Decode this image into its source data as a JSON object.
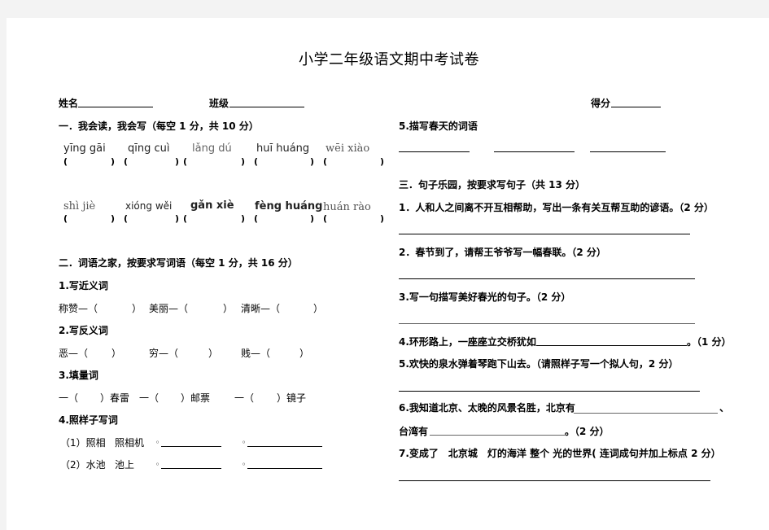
{
  "title": "小学二年级语文期中考试卷",
  "header": {
    "name_label": "姓名",
    "class_label": "班级",
    "score_label": "得分"
  },
  "section1": {
    "heading": "一．我会读，我会写（每空 1 分，共 10 分）",
    "pinyin_row1": [
      "yīng gāi",
      "qīng cuì",
      "lǎng dú",
      "huī huáng",
      "wēi xiào"
    ],
    "pinyin_row2": [
      "shì jiè",
      "xióng wěi",
      "gǎn xiè",
      "fèng huáng",
      "huán rào"
    ],
    "paren_open": "(",
    "paren_close": ")"
  },
  "section2": {
    "heading": "二．词语之家，按要求写词语（每空 1 分，共 16 分）",
    "q1": {
      "label": "1.写近义词",
      "items": [
        "称赞—（",
        "）",
        "美丽—（",
        "）",
        "清晰—（",
        "）"
      ]
    },
    "q2": {
      "label": "2.写反义词",
      "items": [
        "恶—（",
        "）",
        "穷—（",
        "）",
        "贱—（",
        "）"
      ]
    },
    "q3": {
      "label": "3.填量词",
      "items": [
        "一（",
        "）春雷",
        "一（",
        "）邮票",
        "一（",
        "）镜子"
      ]
    },
    "q4": {
      "label": "4.照样子写词",
      "rows": [
        {
          "num": "（1）照相",
          "example": "照相机"
        },
        {
          "num": "（2）水池",
          "example": "池上"
        }
      ],
      "bullet": "◦"
    },
    "q5": {
      "label": "5.描写春天的词语"
    }
  },
  "section3": {
    "heading": "三．句子乐园，按要求写句子（共 13 分）",
    "q1": "1．人和人之间离不开互相帮助，写出一条有关互帮互助的谚语。（2 分）",
    "q2": "2．春节到了，请帮王爷爷写一幅春联。（2 分）",
    "q3": "3.写一句描写美好春光的句子。（2 分）",
    "q4_prefix": "4.环形路上，一座座立交桥犹如",
    "q4_suffix": "。（1 分）",
    "q5": "5.欢快的泉水弹着琴跑下山去。（请照样子写一个拟人句，2 分）",
    "q6_prefix": "6.我知道北京、太晚的风景名胜，北京有",
    "q6_comma": "、",
    "q6_line2_prefix": "台湾有",
    "q6_line2_suffix": "。（2 分）",
    "q7": "7.变成了　北京城　灯的海洋  整个  光的世界(  连词成句并加上标点  2 分）"
  }
}
